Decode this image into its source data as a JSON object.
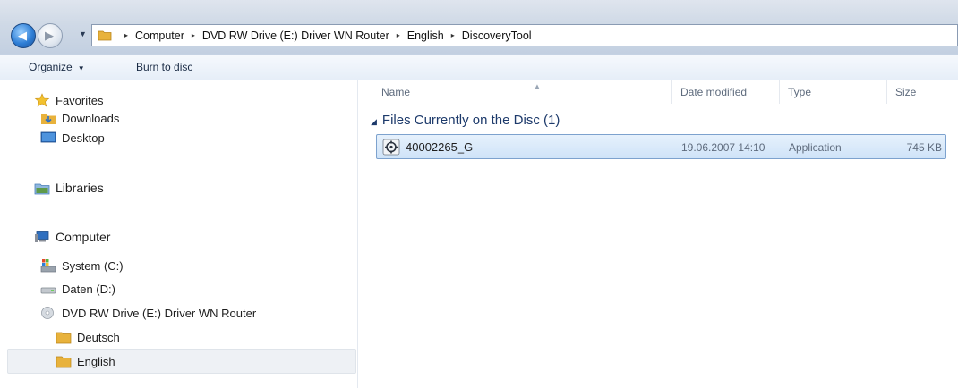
{
  "address": {
    "crumbs": [
      "Computer",
      "DVD RW Drive (E:) Driver WN Router",
      "English",
      "DiscoveryTool"
    ],
    "separator": "▸"
  },
  "toolbar": {
    "organize_label": "Organize",
    "burn_label": "Burn to disc"
  },
  "navpane": {
    "favorites": {
      "label": "Favorites",
      "items": [
        {
          "label": "Downloads"
        },
        {
          "label": "Desktop"
        }
      ]
    },
    "libraries": {
      "label": "Libraries"
    },
    "computer": {
      "label": "Computer",
      "items": [
        {
          "label": "System (C:)"
        },
        {
          "label": "Daten (D:)"
        },
        {
          "label": "DVD RW Drive (E:) Driver WN Router"
        }
      ],
      "folders": [
        {
          "label": "Deutsch"
        },
        {
          "label": "English",
          "selected": true
        }
      ]
    }
  },
  "columns": {
    "name": "Name",
    "date": "Date modified",
    "type": "Type",
    "size": "Size"
  },
  "group_header": "Files Currently on the Disc (1)",
  "files": [
    {
      "name": "40002265_G",
      "date": "19.06.2007 14:10",
      "type": "Application",
      "size": "745 KB",
      "selected": true
    }
  ],
  "colors": {
    "title_bar": "#cfd9e6",
    "selection_fill": "#cfe3f8",
    "selection_border": "#7da2ce",
    "group_text": "#1d3a6b"
  }
}
